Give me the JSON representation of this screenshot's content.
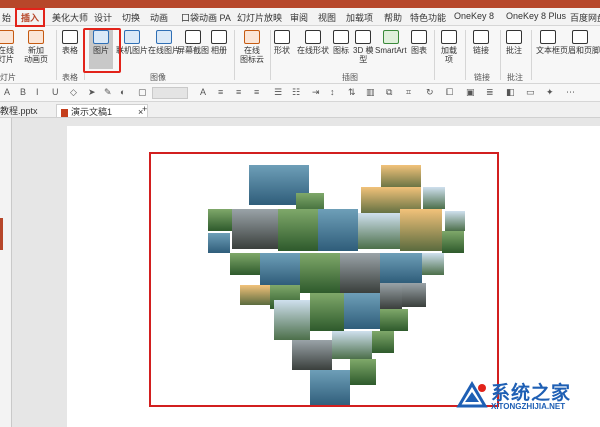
{
  "tabs": [
    {
      "label": "始"
    },
    {
      "label": "插入"
    },
    {
      "label": "美化大师"
    },
    {
      "label": "设计"
    },
    {
      "label": "切换"
    },
    {
      "label": "动画"
    },
    {
      "label": "口袋动画 PA"
    },
    {
      "label": "幻灯片放映"
    },
    {
      "label": "审阅"
    },
    {
      "label": "视图"
    },
    {
      "label": "加载项"
    },
    {
      "label": "帮助"
    },
    {
      "label": "特色功能"
    },
    {
      "label": "OneKey 8"
    },
    {
      "label": "OneKey 8 Plus"
    },
    {
      "label": "百度网盘"
    }
  ],
  "ribbon": {
    "buttons": [
      {
        "label": "在线",
        "label2": "灯片"
      },
      {
        "label": "新加",
        "label2": "动画页"
      },
      {
        "label": "表格"
      },
      {
        "label": "图片"
      },
      {
        "label": "联机图片"
      },
      {
        "label": "在线图片"
      },
      {
        "label": "屏幕截图"
      },
      {
        "label": "相册"
      },
      {
        "label": "在线",
        "label2": "图标云"
      },
      {
        "label": "形状"
      },
      {
        "label": "在线形状"
      },
      {
        "label": "图标"
      },
      {
        "label": "3D 模",
        "label2": "型"
      },
      {
        "label": "SmartArt"
      },
      {
        "label": "图表"
      },
      {
        "label": "加载",
        "label2": "项"
      },
      {
        "label": "链接"
      },
      {
        "label": "批注"
      },
      {
        "label": "文本框"
      },
      {
        "label": "页眉和页脚"
      }
    ],
    "groups": [
      {
        "label": "灯片"
      },
      {
        "label": "表格"
      },
      {
        "label": "图像"
      },
      {
        "label": "插图"
      },
      {
        "label": "链接"
      },
      {
        "label": "批注"
      }
    ]
  },
  "doc_tabs": {
    "file": "教程.pptx",
    "active": "演示文稿1",
    "add": "+"
  },
  "watermark": {
    "name": "系统之家",
    "url": "XITONGZHIJIA.NET"
  },
  "colors": {
    "accent": "#b7472a",
    "highlight": "#e2231a",
    "watermark": "#1e5fb4"
  }
}
